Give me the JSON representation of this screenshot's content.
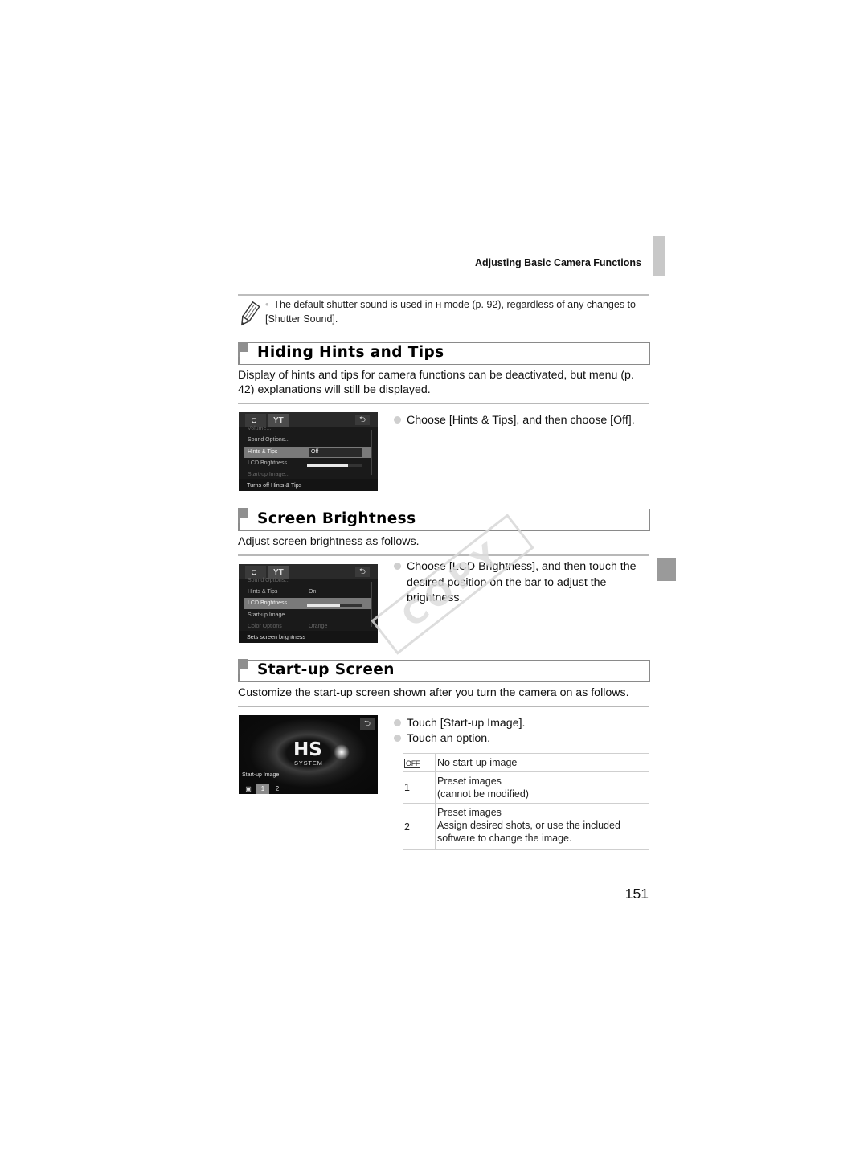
{
  "header": {
    "running_title": "Adjusting Basic Camera Functions"
  },
  "note": {
    "icon": "pencil-icon",
    "text_before_icon": "The default shutter sound is used in",
    "mode_icon": "hs-burst-mode-icon",
    "mode_icon_glyph": "H",
    "text_after_icon": "mode (p. 92), regardless of any changes to [Shutter Sound]."
  },
  "sections": [
    {
      "title": "Hiding Hints and Tips",
      "intro": "Display of hints and tips for camera functions can be deactivated, but menu (p. 42) explanations will still be displayed.",
      "steps": [
        "Choose [Hints & Tips], and then choose [Off]."
      ],
      "screen": {
        "tabs": [
          "camera-tab",
          "settings-tab"
        ],
        "back_glyph": "⮌",
        "rows": [
          {
            "label": "Volume...",
            "state": "dim"
          },
          {
            "label": "Sound Options...",
            "state": "normal"
          },
          {
            "label": "Hints & Tips",
            "value": "Off",
            "state": "selected"
          },
          {
            "label": "LCD Brightness",
            "state": "normal"
          },
          {
            "label": "Start-up Image...",
            "state": "dim"
          }
        ],
        "brightness_level": 0.75,
        "hint": "Turns off Hints & Tips"
      }
    },
    {
      "title": "Screen Brightness",
      "intro": "Adjust screen brightness as follows.",
      "steps": [
        "Choose [LCD Brightness], and then touch the desired position on the bar to adjust the brightness."
      ],
      "screen": {
        "back_glyph": "⮌",
        "rows": [
          {
            "label": "Sound Options...",
            "state": "dim"
          },
          {
            "label": "Hints & Tips",
            "value": "On",
            "state": "normal"
          },
          {
            "label": "LCD Brightness",
            "state": "selected"
          },
          {
            "label": "Start-up Image...",
            "state": "normal"
          },
          {
            "label": "Color Options",
            "value": "Orange",
            "state": "dim"
          }
        ],
        "brightness_level": 0.6,
        "hint": "Sets screen brightness"
      }
    },
    {
      "title": "Start-up Screen",
      "intro": "Customize the start-up screen shown after you turn the camera on as follows.",
      "steps": [
        "Touch [Start-up Image].",
        "Touch an option."
      ],
      "screen": {
        "logo": "HS",
        "logo_sub": "SYSTEM",
        "back_glyph": "⮌",
        "label": "Start-up Image",
        "options": [
          "off",
          "1",
          "2"
        ],
        "selected_option": "1"
      },
      "options_table": [
        {
          "key_icon": "off-icon",
          "key_text": "OFF",
          "desc": [
            "No start-up image"
          ]
        },
        {
          "key_text": "1",
          "desc": [
            "Preset images",
            "(cannot be modified)"
          ]
        },
        {
          "key_text": "2",
          "desc": [
            "Preset images",
            "Assign desired shots, or use the included",
            "software to change the image."
          ]
        }
      ]
    }
  ],
  "watermark": "COPY",
  "page_number": "151"
}
